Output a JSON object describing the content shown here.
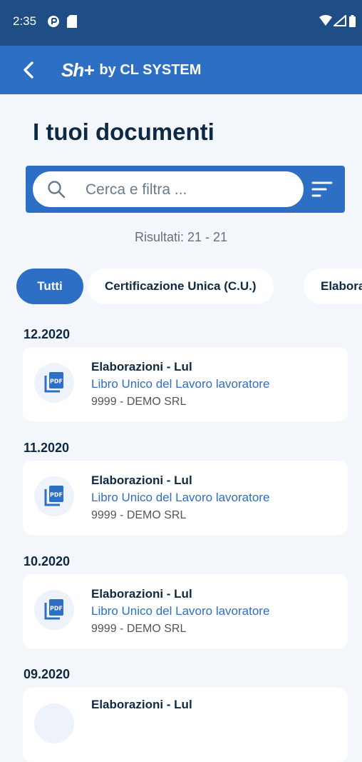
{
  "status_bar": {
    "time": "2:35"
  },
  "app_bar": {
    "logo_mark": "Sh+",
    "logo_text": "by CL SYSTEM"
  },
  "page_title": "I tuoi documenti",
  "search": {
    "placeholder": "Cerca e filtra ..."
  },
  "results_text": "Risultati: 21 - 21",
  "chips": [
    {
      "label": "Tutti",
      "active": true
    },
    {
      "label": "Certificazione Unica (C.U.)",
      "active": false
    },
    {
      "label": "Elaborazioni",
      "active": false
    }
  ],
  "groups": [
    {
      "month": "12.2020",
      "title": "Elaborazioni - Lul",
      "subtitle": "Libro Unico del Lavoro lavoratore",
      "company": "9999 - DEMO SRL"
    },
    {
      "month": "11.2020",
      "title": "Elaborazioni - Lul",
      "subtitle": "Libro Unico del Lavoro lavoratore",
      "company": "9999 - DEMO SRL"
    },
    {
      "month": "10.2020",
      "title": "Elaborazioni - Lul",
      "subtitle": "Libro Unico del Lavoro lavoratore",
      "company": "9999 - DEMO SRL"
    },
    {
      "month": "09.2020",
      "title": "Elaborazioni - Lul",
      "subtitle": "",
      "company": ""
    }
  ],
  "colors": {
    "primary": "#2d6fc4",
    "status_bar": "#1f4d86",
    "background": "#f3f6fb"
  }
}
